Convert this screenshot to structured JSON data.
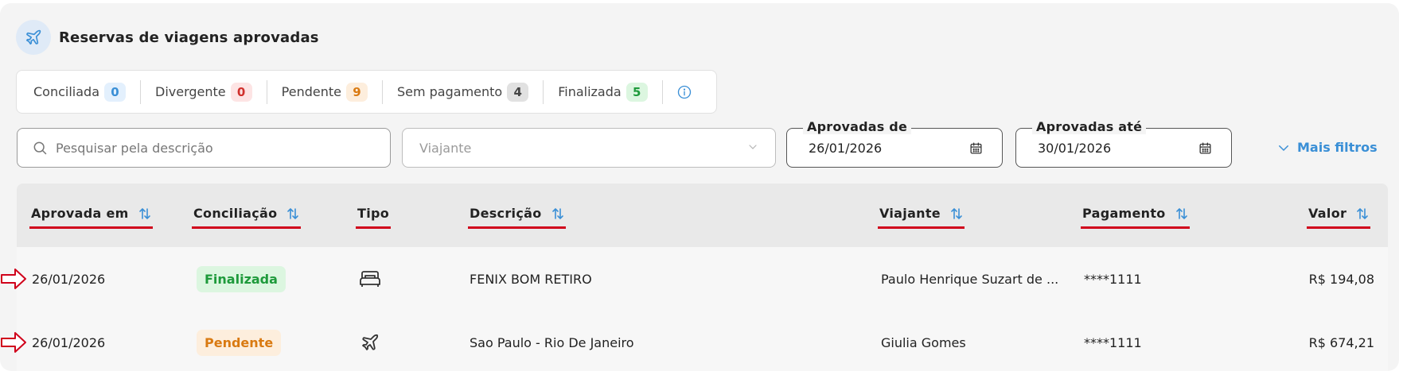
{
  "header": {
    "title": "Reservas de viagens aprovadas",
    "icon": "plane-icon"
  },
  "statuses": [
    {
      "label": "Conciliada",
      "count": "0",
      "bg": "#e3f0fd",
      "fg": "#3a8fd6"
    },
    {
      "label": "Divergente",
      "count": "0",
      "bg": "#fde4e4",
      "fg": "#d0312d"
    },
    {
      "label": "Pendente",
      "count": "9",
      "bg": "#fdeedd",
      "fg": "#d97a12"
    },
    {
      "label": "Sem pagamento",
      "count": "4",
      "bg": "#e1e1e1",
      "fg": "#444444"
    },
    {
      "label": "Finalizada",
      "count": "5",
      "bg": "#dcf6e0",
      "fg": "#1e9a3b"
    }
  ],
  "filters": {
    "search_placeholder": "Pesquisar pela descrição",
    "traveler_placeholder": "Viajante",
    "approved_from_label": "Aprovadas de",
    "approved_from_value": "26/01/2026",
    "approved_to_label": "Aprovadas até",
    "approved_to_value": "30/01/2026",
    "more_filters": "Mais filtros"
  },
  "table": {
    "headers": {
      "approved_at": "Aprovada em",
      "reconciliation": "Conciliação",
      "type": "Tipo",
      "description": "Descrição",
      "traveler": "Viajante",
      "payment": "Pagamento",
      "value": "Valor"
    },
    "rows": [
      {
        "approved_at": "26/01/2026",
        "status": "Finalizada",
        "type_icon": "bed-icon",
        "description": "FENIX BOM RETIRO",
        "traveler": "Paulo Henrique Suzart de ...",
        "payment": "****1111",
        "value": "R$ 194,08"
      },
      {
        "approved_at": "26/01/2026",
        "status": "Pendente",
        "type_icon": "plane-icon",
        "description": "Sao Paulo - Rio De Janeiro",
        "traveler": "Giulia Gomes",
        "payment": "****1111",
        "value": "R$ 674,21"
      }
    ]
  },
  "colors": {
    "accent": "#3a8fd6",
    "annotation_red": "#d0021b",
    "finalizada_bg": "#dcf6e0",
    "finalizada_fg": "#1e9a3b",
    "pendente_bg": "#fdeedd",
    "pendente_fg": "#d97a12"
  }
}
